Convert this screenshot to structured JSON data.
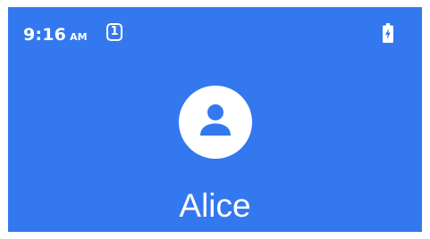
{
  "status_bar": {
    "time": "9:16",
    "ampm": "AM",
    "notification_count": "1",
    "battery_icon": "battery-charging-icon"
  },
  "contact": {
    "avatar_icon": "person-icon",
    "name": "Alice"
  },
  "colors": {
    "background": "#3478F0",
    "foreground": "#FFFFFF"
  }
}
